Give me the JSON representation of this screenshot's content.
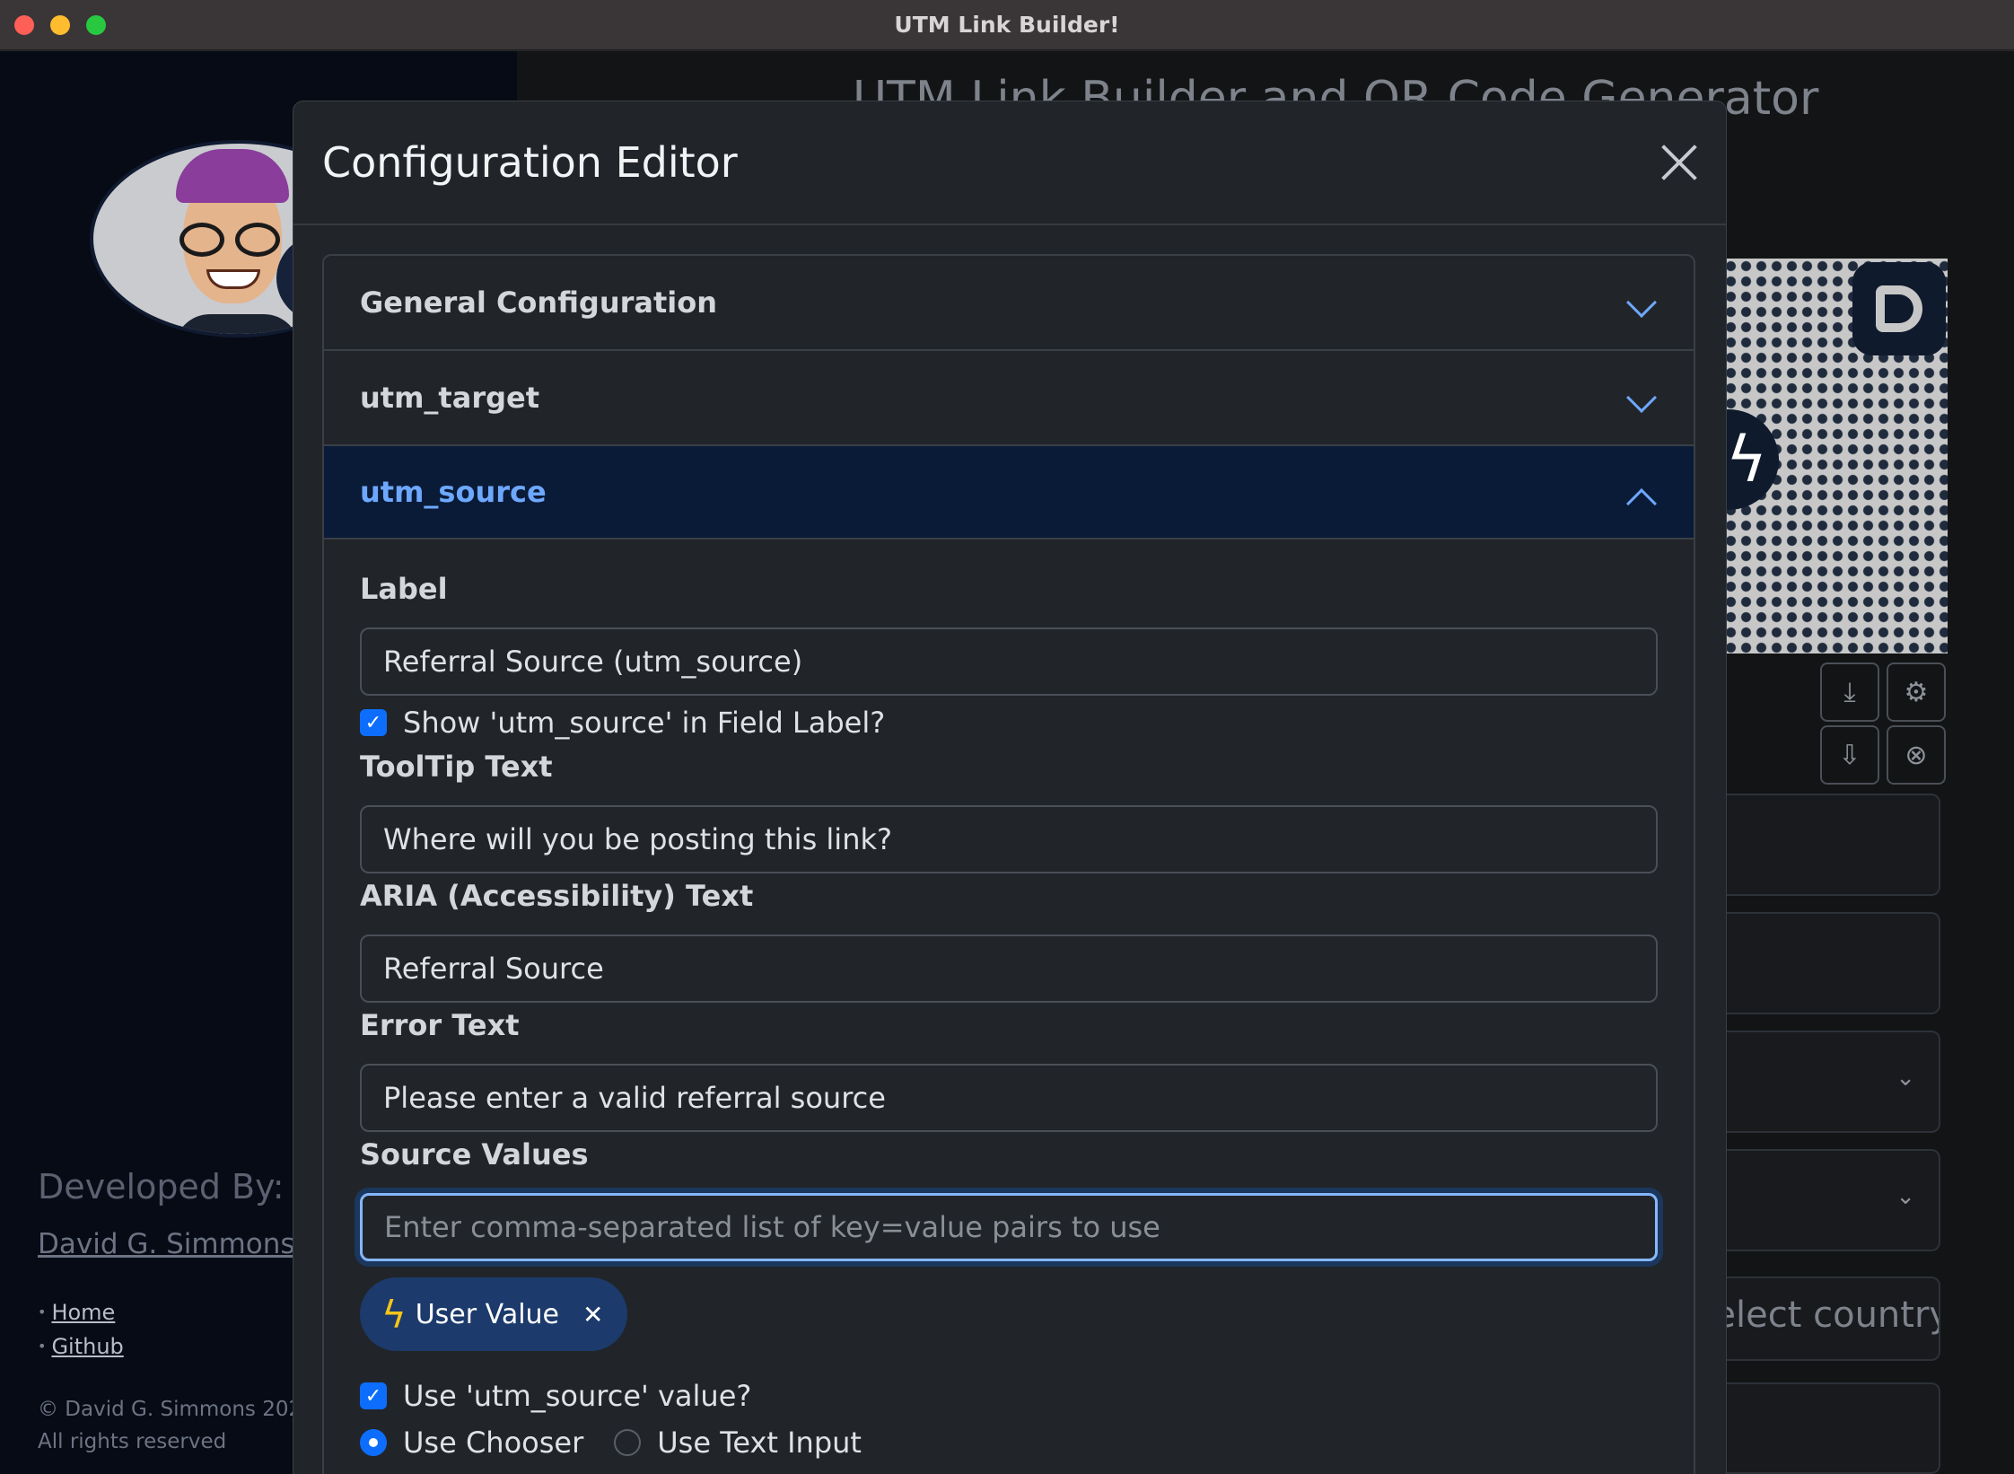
{
  "window": {
    "title": "UTM Link Builder!"
  },
  "background": {
    "heading": "UTM Link Builder and QR Code Generator",
    "country_placeholder": "Select country"
  },
  "sidebar": {
    "developed_by": "Developed By:",
    "developer_name": "David G. Simmons",
    "links": [
      "Home",
      "Github"
    ],
    "copyright": "© David G. Simmons 2023",
    "rights": "All rights reserved"
  },
  "modal": {
    "title": "Configuration Editor",
    "sections": [
      "General Configuration",
      "utm_target",
      "utm_source"
    ],
    "active_section": "utm_source",
    "form": {
      "label_title": "Label",
      "label_value": "Referral Source (utm_source)",
      "show_label_text": "Show 'utm_source' in Field Label?",
      "show_label_checked": true,
      "tooltip_title": "ToolTip Text",
      "tooltip_value": "Where will you be posting this link?",
      "aria_title": "ARIA (Accessibility) Text",
      "aria_value": "Referral Source",
      "error_title": "Error Text",
      "error_value": "Please enter a valid referral source",
      "source_values_title": "Source Values",
      "source_values_placeholder": "Enter comma-separated list of key=value pairs to use",
      "chip_label": "User Value",
      "use_value_text": "Use 'utm_source' value?",
      "use_value_checked": true,
      "radio_chooser": "Use Chooser",
      "radio_text_input": "Use Text Input",
      "radio_selected": "Use Chooser"
    }
  },
  "colors": {
    "accent": "#0d6efd",
    "active_header_bg": "#0a1b38",
    "active_header_text": "#6ea8fe",
    "chip_bg": "#1c3a6b"
  }
}
